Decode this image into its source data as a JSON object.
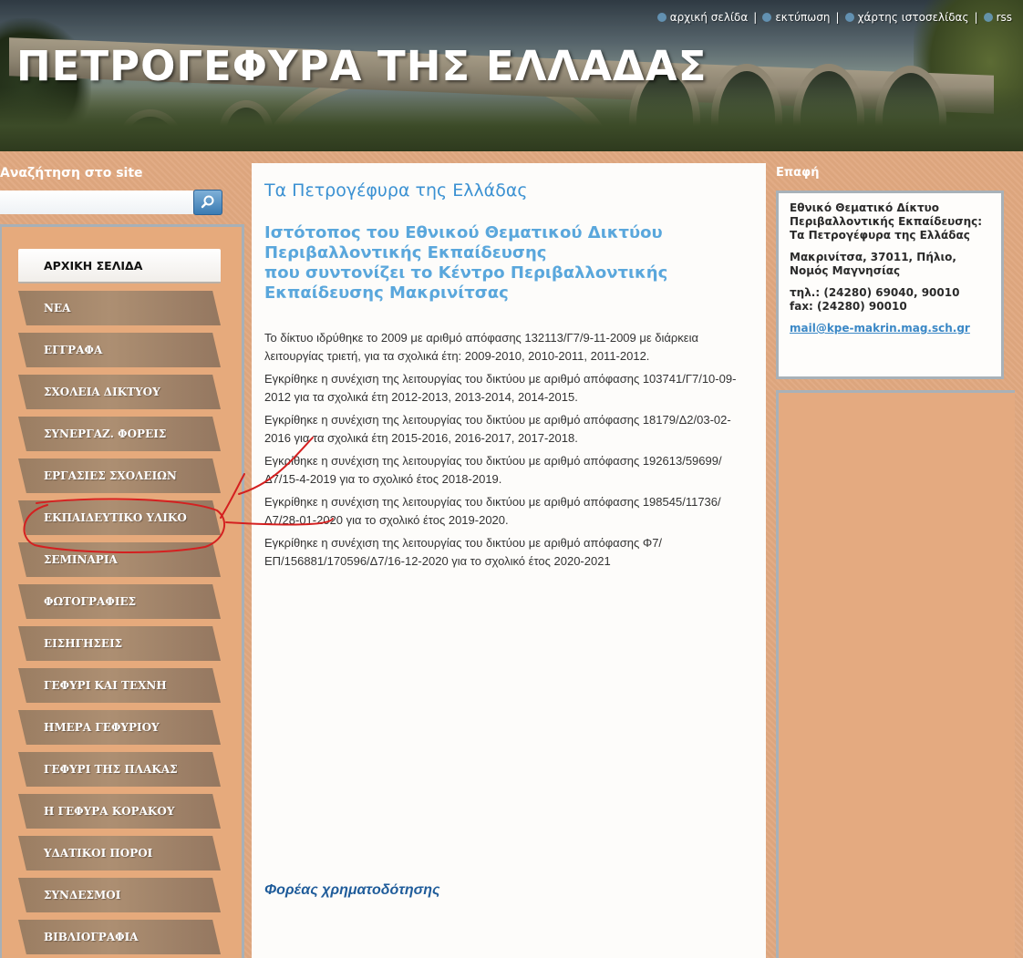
{
  "header": {
    "site_title": "ΠΕΤΡΟΓΕΦΥΡΑ ΤΗΣ ΕΛΛΑΔΑΣ",
    "links": [
      {
        "label": "αρχική σελίδα",
        "icon": "home-icon"
      },
      {
        "label": "εκτύπωση",
        "icon": "print-icon"
      },
      {
        "label": "χάρτης ιστοσελίδας",
        "icon": "sitemap-icon"
      },
      {
        "label": "rss",
        "icon": "rss-icon"
      }
    ],
    "separator": "|"
  },
  "search": {
    "label": "Αναζήτηση στο site",
    "value": "",
    "placeholder": "",
    "button_icon": "search-icon"
  },
  "nav": {
    "items": [
      {
        "label": "ΑΡΧΙΚΗ ΣΕΛΙΔΑ",
        "active": true
      },
      {
        "label": "ΝΕΑ"
      },
      {
        "label": "ΕΓΓΡΑΦΑ"
      },
      {
        "label": "ΣΧΟΛΕΙΑ ΔΙΚΤΥΟΥ"
      },
      {
        "label": "ΣΥΝΕΡΓΑΖ. ΦΟΡΕΙΣ"
      },
      {
        "label": "ΕΡΓΑΣΙΕΣ ΣΧΟΛΕΙΩΝ"
      },
      {
        "label": "ΕΚΠΑΙΔΕΥΤΙΚΟ ΥΛΙΚΟ",
        "circled": true
      },
      {
        "label": "ΣΕΜΙΝΑΡΙΑ"
      },
      {
        "label": "ΦΩΤΟΓΡΑΦΙΕΣ"
      },
      {
        "label": "ΕΙΣΗΓΗΣΕΙΣ"
      },
      {
        "label": "ΓΕΦΥΡΙ ΚΑΙ ΤΕΧΝΗ"
      },
      {
        "label": "ΗΜΕΡΑ ΓΕΦΥΡΙΟΥ"
      },
      {
        "label": "ΓΕΦΥΡΙ ΤΗΣ ΠΛΑΚΑΣ"
      },
      {
        "label": "Η ΓΕΦΥΡΑ ΚΟΡΑΚΟΥ"
      },
      {
        "label": "ΥΔΑΤΙΚΟΙ ΠΟΡΟΙ"
      },
      {
        "label": "ΣΥΝΔΕΣΜΟΙ"
      },
      {
        "label": "ΒΙΒΛΙΟΓΡΑΦΙΑ"
      }
    ]
  },
  "main": {
    "title": "Τα Πετρογέφυρα της Ελλάδας",
    "subtitle": "Ιστότοπος του Εθνικού Θεματικού Δικτύου\nΠεριβαλλοντικής Εκπαίδευσης\nπου συντονίζει το Κέντρο Περιβαλλοντικής\nΕκπαίδευσης Μακρινίτσας",
    "paragraphs": [
      "Το δίκτυο ιδρύθηκε το 2009 με αριθμό απόφασης 132113/Γ7/9-11-2009 με διάρκεια λειτουργίας τριετή, για τα σχολικά έτη: 2009-2010, 2010-2011, 2011-2012.",
      "Εγκρίθηκε η συνέχιση της λειτουργίας του δικτύου με αριθμό απόφασης 103741/Γ7/10-09-2012 για τα σχολικά έτη 2012-2013, 2013-2014, 2014-2015.",
      "Εγκρίθηκε η συνέχιση της λειτουργίας του δικτύου με αριθμό απόφασης 18179/Δ2/03-02-2016 για τα σχολικά έτη 2015-2016, 2016-2017, 2017-2018.",
      "Εγκρίθηκε η συνέχιση της λειτουργίας του δικτύου με αριθμό απόφασης 192613/59699/Δ7/15-4-2019 για το σχολικό έτος 2018-2019.",
      "Εγκρίθηκε η συνέχιση της λειτουργίας του δικτύου με αριθμό απόφασης 198545/11736/Δ7/28-01-2020 για το σχολικό έτος 2019-2020.",
      "Εγκρίθηκε η συνέχιση της λειτουργίας του δικτύου με αριθμό απόφασης  Φ7/ΕΠ/156881/170596/Δ7/16-12-2020 για το σχολικό έτος 2020-2021"
    ],
    "funding_heading": "Φορέας χρηματοδότησης"
  },
  "contact": {
    "title": "Επαφή",
    "org": "Εθνικό Θεματικό Δίκτυο Περιβαλλοντικής Εκπαίδευσης: Τα Πετρογέφυρα της Ελλάδας",
    "address": "Μακρινίτσα, 37011, Πήλιο, Νομός Μαγνησίας",
    "phone": "τηλ.: (24280) 69040, 90010",
    "fax": "fax: (24280) 90010",
    "email": "mail@kpe-makrin.mag.sch.gr"
  },
  "colors": {
    "page_bg": "#e0a880",
    "heading_blue": "#3b91d2",
    "link_blue": "#3b88c6",
    "nav_tab": "#a78a6e",
    "annotation_red": "#d42020"
  }
}
